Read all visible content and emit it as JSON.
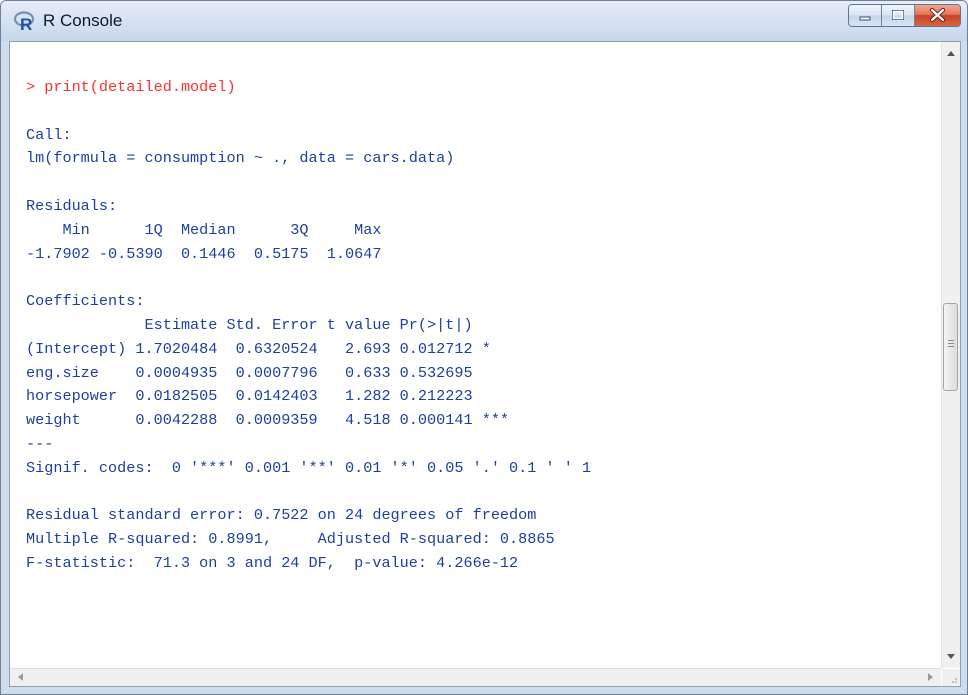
{
  "window": {
    "title": "R Console",
    "app_icon": "r-logo-icon",
    "buttons": [
      "minimize",
      "maximize",
      "close"
    ]
  },
  "console": {
    "lines": [
      {
        "text": "> print(detailed.model)",
        "type": "command"
      },
      {
        "text": "",
        "type": "output"
      },
      {
        "text": "Call:",
        "type": "output"
      },
      {
        "text": "lm(formula = consumption ~ ., data = cars.data)",
        "type": "output"
      },
      {
        "text": "",
        "type": "output"
      },
      {
        "text": "Residuals:",
        "type": "output"
      },
      {
        "text": "    Min      1Q  Median      3Q     Max ",
        "type": "output"
      },
      {
        "text": "-1.7902 -0.5390  0.1446  0.5175  1.0647 ",
        "type": "output"
      },
      {
        "text": "",
        "type": "output"
      },
      {
        "text": "Coefficients:",
        "type": "output"
      },
      {
        "text": "             Estimate Std. Error t value Pr(>|t|)    ",
        "type": "output"
      },
      {
        "text": "(Intercept) 1.7020484  0.6320524   2.693 0.012712 *  ",
        "type": "output"
      },
      {
        "text": "eng.size    0.0004935  0.0007796   0.633 0.532695    ",
        "type": "output"
      },
      {
        "text": "horsepower  0.0182505  0.0142403   1.282 0.212223    ",
        "type": "output"
      },
      {
        "text": "weight      0.0042288  0.0009359   4.518 0.000141 ***",
        "type": "output"
      },
      {
        "text": "---",
        "type": "output"
      },
      {
        "text": "Signif. codes:  0 '***' 0.001 '**' 0.01 '*' 0.05 '.' 0.1 ' ' 1 ",
        "type": "output"
      },
      {
        "text": "",
        "type": "output"
      },
      {
        "text": "Residual standard error: 0.7522 on 24 degrees of freedom",
        "type": "output"
      },
      {
        "text": "Multiple R-squared: 0.8991,\tAdjusted R-squared: 0.8865 ",
        "type": "output"
      },
      {
        "text": "F-statistic:  71.3 on 3 and 24 DF,  p-value: 4.266e-12",
        "type": "output"
      }
    ]
  },
  "colors": {
    "command": "#ff3030",
    "output": "#1f3fa0",
    "titlebar": "#d4e1f1",
    "close_button": "#c7432a"
  }
}
